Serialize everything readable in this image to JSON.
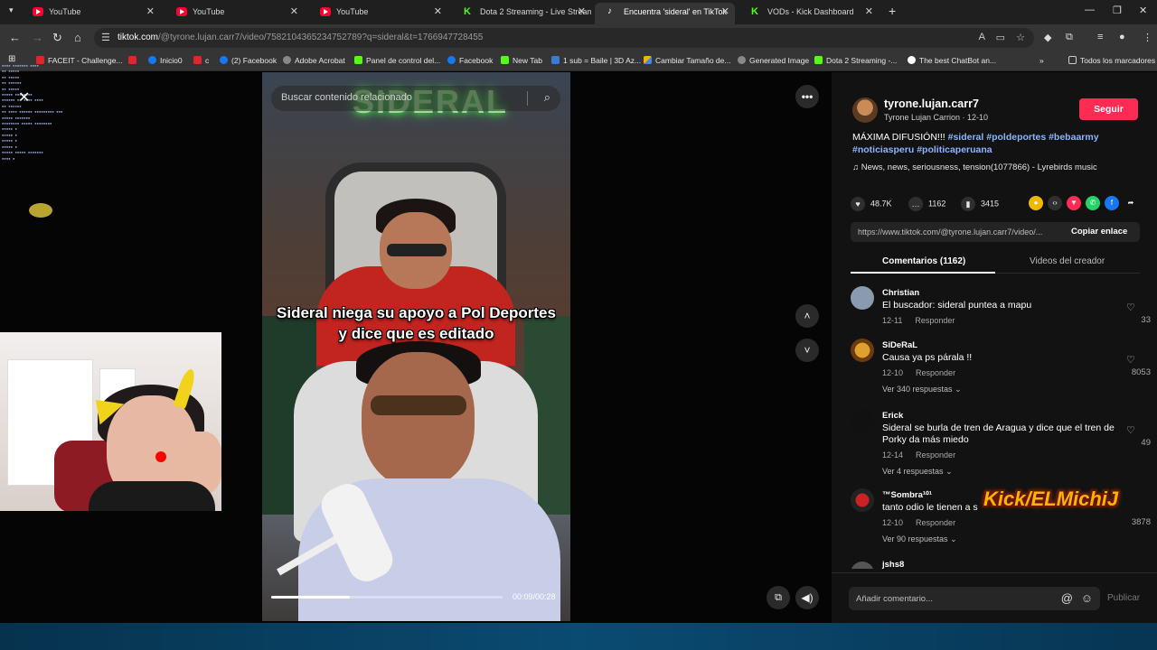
{
  "browser": {
    "tabs": [
      {
        "title": "YouTube",
        "icon": "youtube-icon"
      },
      {
        "title": "YouTube",
        "icon": "youtube-icon"
      },
      {
        "title": "YouTube",
        "icon": "youtube-icon"
      },
      {
        "title": "Dota 2 Streaming - Live Stream",
        "icon": "kick-icon"
      },
      {
        "title": "Encuentra 'sideral' en TikTok",
        "icon": "tiktok-icon"
      },
      {
        "title": "VODs - Kick Dashboard",
        "icon": "kick-icon"
      }
    ],
    "url_host": "tiktok.com",
    "url_path": "/@tyrone.lujan.carr7/video/7582104365234752789?q=sideral&t=1766947728455",
    "bookmarks": [
      {
        "label": "FACEIT - Challenge...",
        "icon": "red"
      },
      {
        "label": "Inicio0",
        "icon": "fb"
      },
      {
        "label": "c",
        "icon": "red"
      },
      {
        "label": "(2) Facebook",
        "icon": "fb"
      },
      {
        "label": "Adobe Acrobat",
        "icon": "gray"
      },
      {
        "label": "Panel de control del...",
        "icon": "kick"
      },
      {
        "label": "Facebook",
        "icon": "fb"
      },
      {
        "label": "New Tab",
        "icon": "kick"
      },
      {
        "label": "1 sub = Baile | 3D Az...",
        "icon": "blue"
      },
      {
        "label": "Cambiar Tamaño de...",
        "icon": "multi"
      },
      {
        "label": "Generated Image",
        "icon": "gray"
      },
      {
        "label": "Dota 2 Streaming -...",
        "icon": "kick"
      },
      {
        "label": "The best ChatBot an...",
        "icon": "white"
      }
    ],
    "all_bookmarks": "Todos los marcadores"
  },
  "video": {
    "search_placeholder": "Buscar contenido relacionado",
    "caption_line1": "Sideral niega su apoyo a Pol Deportes",
    "caption_line2": "y dice que es editado",
    "time": "00:09/00:28",
    "progress": 0.34,
    "neon_text": "SIDERAL"
  },
  "overlay": {
    "kick_tag": "Kick/ELMichiJ"
  },
  "panel": {
    "username": "tyrone.lujan.carr7",
    "subline": "Tyrone Lujan Carrion · 12-10",
    "follow_label": "Seguir",
    "desc_text": "MÁXIMA DIFUSIÓN!!!",
    "hashtags": [
      "#sideral",
      "#poldeportes",
      "#bebaarmy",
      "#noticiasperu",
      "#politicaperuana"
    ],
    "music": "News, news, seriousness, tension(1077866) - Lyrebirds music",
    "likes": "48.7K",
    "comments_count": "1162",
    "saves": "3415",
    "link_url": "https://www.tiktok.com/@tyrone.lujan.carr7/video/...",
    "copy_link": "Copiar enlace",
    "tab_comments": "Comentarios (1162)",
    "tab_creator": "Videos del creador",
    "comments": [
      {
        "name": "Christian",
        "text": "El buscador: sideral puntea a mapu",
        "date": "12-11",
        "reply": "Responder",
        "likes": "33",
        "more": ""
      },
      {
        "name": "SiDeRaL",
        "text": "Causa ya ps párala !!",
        "date": "12-10",
        "reply": "Responder",
        "likes": "8053",
        "more": "Ver 340 respuestas"
      },
      {
        "name": "Erick",
        "text": "Sideral se burla de tren de Aragua y dice que el tren de Porky da más miedo",
        "date": "12-14",
        "reply": "Responder",
        "likes": "49",
        "more": "Ver 4 respuestas"
      },
      {
        "name": "™Sombra¹⁰¹",
        "text": "tanto odio le tienen a s",
        "date": "12-10",
        "reply": "Responder",
        "likes": "3878",
        "more": "Ver 90 respuestas"
      },
      {
        "name": "jshs8",
        "text": "",
        "date": "",
        "reply": "",
        "likes": "",
        "more": ""
      }
    ],
    "comment_placeholder": "Añadir comentario...",
    "publish_label": "Publicar"
  },
  "colors": {
    "accent": "#fe2c55",
    "hashtag": "#8cb4ff",
    "kick_green": "#53fc18"
  }
}
